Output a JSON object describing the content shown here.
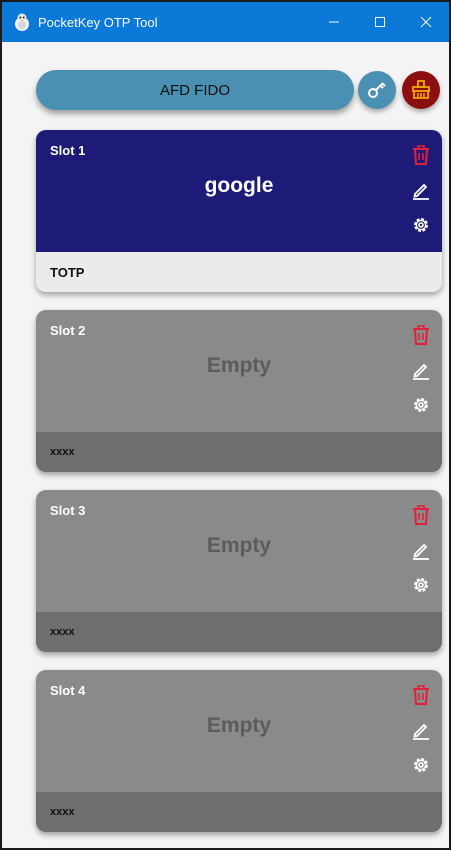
{
  "window": {
    "title": "PocketKey OTP Tool",
    "controls": [
      "minimize-icon",
      "maximize-icon",
      "close-icon"
    ],
    "titlebar_color": "#0a79d8"
  },
  "toolbar": {
    "device_name": "AFD FIDO",
    "key_button_icon": "key-icon",
    "clear_button_icon": "broom-icon",
    "accent_color": "#4a90b2",
    "danger_color": "#8b0f0f"
  },
  "slots": [
    {
      "title": "Slot 1",
      "label": "google",
      "type": "TOTP",
      "state": "configured"
    },
    {
      "title": "Slot 2",
      "label": "Empty",
      "type": "xxxx",
      "state": "empty"
    },
    {
      "title": "Slot 3",
      "label": "Empty",
      "type": "xxxx",
      "state": "empty"
    },
    {
      "title": "Slot 4",
      "label": "Empty",
      "type": "xxxx",
      "state": "empty"
    }
  ],
  "slot_actions": [
    "trash-icon",
    "edit-icon",
    "gear-icon"
  ],
  "colors": {
    "configured_bg": "#1e1a78",
    "empty_bg": "#8a8a8a",
    "delete_icon": "#e3203a"
  }
}
